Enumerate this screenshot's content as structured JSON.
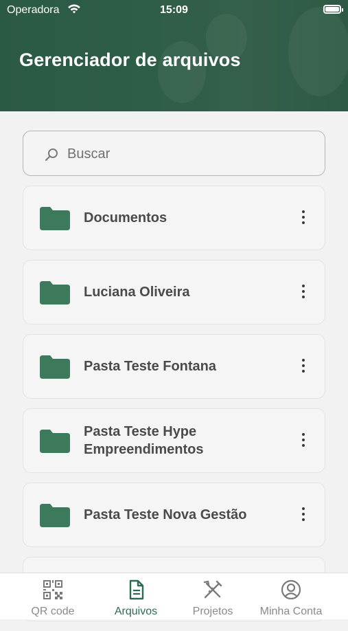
{
  "status_bar": {
    "carrier": "Operadora",
    "time": "15:09"
  },
  "header": {
    "title": "Gerenciador de arquivos"
  },
  "search": {
    "placeholder": "Buscar",
    "icon": "search-icon"
  },
  "folders": [
    {
      "name": "Documentos"
    },
    {
      "name": "Luciana Oliveira"
    },
    {
      "name": "Pasta Teste Fontana"
    },
    {
      "name": "Pasta Teste Hype Empreendimentos"
    },
    {
      "name": "Pasta Teste Nova Gestão"
    },
    {
      "name": ""
    }
  ],
  "tabs": [
    {
      "label": "QR code",
      "icon": "qr-code-icon",
      "active": false
    },
    {
      "label": "Arquivos",
      "icon": "file-icon",
      "active": true
    },
    {
      "label": "Projetos",
      "icon": "tools-icon",
      "active": false
    },
    {
      "label": "Minha Conta",
      "icon": "user-circle-icon",
      "active": false
    }
  ],
  "colors": {
    "header": "#2f5e48",
    "folder": "#3d7a5b",
    "active_tab": "#2d6a4f",
    "inactive_tab": "#8a8a8a"
  }
}
